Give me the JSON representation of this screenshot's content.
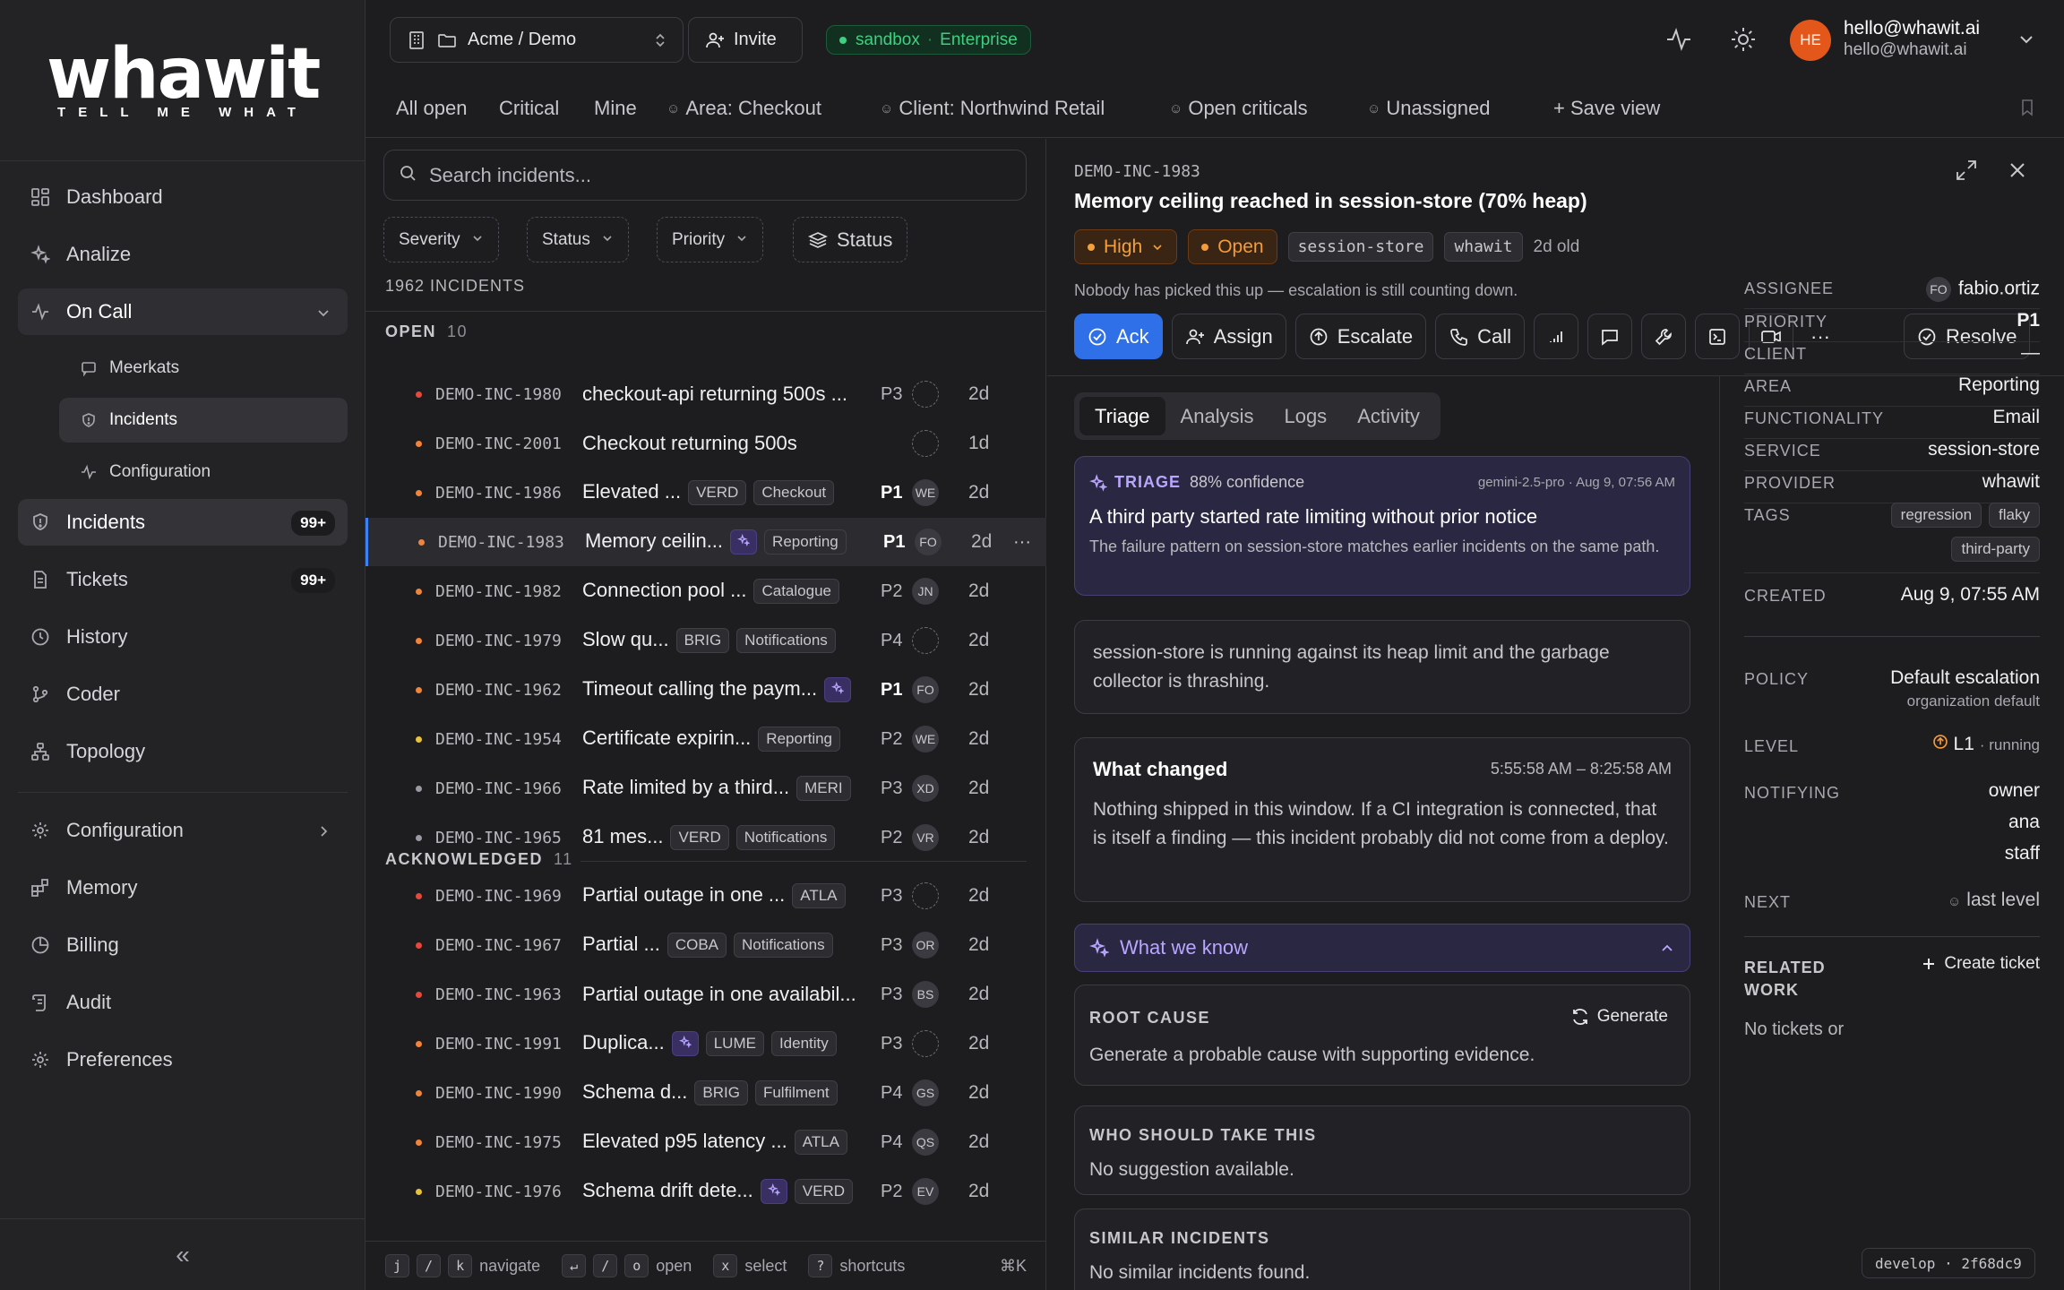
{
  "brand": {
    "name": "whawit",
    "tagline": "TELL ME WHAT"
  },
  "sidebar": {
    "items": [
      {
        "label": "Dashboard"
      },
      {
        "label": "Analize"
      },
      {
        "label": "On Call"
      },
      {
        "label": "Meerkats"
      },
      {
        "label": "Incidents"
      },
      {
        "label": "Configuration"
      },
      {
        "label": "Incidents",
        "badge": "99+"
      },
      {
        "label": "Tickets",
        "badge": "99+"
      },
      {
        "label": "History"
      },
      {
        "label": "Coder"
      },
      {
        "label": "Topology"
      },
      {
        "label": "Configuration"
      },
      {
        "label": "Memory"
      },
      {
        "label": "Billing"
      },
      {
        "label": "Audit"
      },
      {
        "label": "Preferences"
      }
    ],
    "collapse_glyph": "«"
  },
  "topbar": {
    "workspace": "Acme / Demo",
    "invite": "Invite",
    "env": "sandbox",
    "env_sep": "·",
    "plan": "Enterprise",
    "avatar_initials": "HE",
    "user_email": "hello@whawit.ai",
    "user_email_secondary": "hello@whawit.ai"
  },
  "views": [
    "All open",
    "Critical",
    "Mine",
    "Area: Checkout",
    "Client: Northwind Retail",
    "Open criticals",
    "Unassigned",
    "+ Save view"
  ],
  "list": {
    "search_placeholder": "Search incidents...",
    "filters": [
      "Severity",
      "Status",
      "Priority",
      "Status"
    ],
    "total": "1962 INCIDENTS",
    "groups": [
      {
        "name": "OPEN",
        "count": "10"
      },
      {
        "name": "ACKNOWLEDGED",
        "count": "11"
      }
    ],
    "rows": [
      {
        "id": "DEMO-INC-1980",
        "title": "checkout-api returning 500s ...",
        "chips": [],
        "prio": "P3",
        "av": "",
        "age": "2d",
        "dot": "#e8483c"
      },
      {
        "id": "DEMO-INC-2001",
        "title": "Checkout returning 500s",
        "chips": [],
        "prio": "",
        "av": "",
        "age": "1d",
        "dot": "#f0843c"
      },
      {
        "id": "DEMO-INC-1986",
        "title": "Elevated ...",
        "chips": [
          "VERD",
          "Checkout"
        ],
        "prio": "P1",
        "av": "WE",
        "age": "2d",
        "dot": "#f0843c"
      },
      {
        "id": "DEMO-INC-1983",
        "title": "Memory ceilin...",
        "chips": [
          "AI",
          "Reporting"
        ],
        "prio": "P1",
        "av": "FO",
        "age": "2d",
        "dot": "#f0843c",
        "selected": true,
        "more": "···"
      },
      {
        "id": "DEMO-INC-1982",
        "title": "Connection pool ...",
        "chips": [
          "Catalogue"
        ],
        "prio": "P2",
        "av": "JN",
        "age": "2d",
        "dot": "#f0843c"
      },
      {
        "id": "DEMO-INC-1979",
        "title": "Slow qu...",
        "chips": [
          "BRIG",
          "Notifications"
        ],
        "prio": "P4",
        "av": "",
        "age": "2d",
        "dot": "#f0843c"
      },
      {
        "id": "DEMO-INC-1962",
        "title": "Timeout calling the paym...",
        "chips": [
          "AI"
        ],
        "prio": "P1",
        "av": "FO",
        "age": "2d",
        "dot": "#f0843c"
      },
      {
        "id": "DEMO-INC-1954",
        "title": "Certificate expirin...",
        "chips": [
          "Reporting"
        ],
        "prio": "P2",
        "av": "WE",
        "age": "2d",
        "dot": "#e8c23c"
      },
      {
        "id": "DEMO-INC-1966",
        "title": "Rate limited by a third...",
        "chips": [
          "MERI"
        ],
        "prio": "P3",
        "av": "XD",
        "age": "2d",
        "dot": "#9a9aa2"
      },
      {
        "id": "DEMO-INC-1965",
        "title": "81 mes...",
        "chips": [
          "VERD",
          "Notifications"
        ],
        "prio": "P2",
        "av": "VR",
        "age": "2d",
        "dot": "#9a9aa2"
      },
      {
        "id": "DEMO-INC-1969",
        "title": "Partial outage in one ...",
        "chips": [
          "ATLA"
        ],
        "prio": "P3",
        "av": "",
        "age": "2d",
        "dot": "#e8483c"
      },
      {
        "id": "DEMO-INC-1967",
        "title": "Partial ...",
        "chips": [
          "COBA",
          "Notifications"
        ],
        "prio": "P3",
        "av": "OR",
        "age": "2d",
        "dot": "#e8483c"
      },
      {
        "id": "DEMO-INC-1963",
        "title": "Partial outage in one availabil...",
        "chips": [],
        "prio": "P3",
        "av": "BS",
        "age": "2d",
        "dot": "#e8483c"
      },
      {
        "id": "DEMO-INC-1991",
        "title": "Duplica...",
        "chips": [
          "AI",
          "LUME",
          "Identity"
        ],
        "prio": "P3",
        "av": "",
        "age": "2d",
        "dot": "#f0843c"
      },
      {
        "id": "DEMO-INC-1990",
        "title": "Schema d...",
        "chips": [
          "BRIG",
          "Fulfilment"
        ],
        "prio": "P4",
        "av": "GS",
        "age": "2d",
        "dot": "#f0843c"
      },
      {
        "id": "DEMO-INC-1975",
        "title": "Elevated p95 latency ...",
        "chips": [
          "ATLA"
        ],
        "prio": "P4",
        "av": "QS",
        "age": "2d",
        "dot": "#f0843c"
      },
      {
        "id": "DEMO-INC-1976",
        "title": "Schema drift dete...",
        "chips": [
          "AI",
          "VERD"
        ],
        "prio": "P2",
        "av": "EV",
        "age": "2d",
        "dot": "#e8c23c"
      }
    ],
    "shortcuts": [
      {
        "keys": [
          "j",
          "/",
          "k"
        ],
        "label": "navigate"
      },
      {
        "keys": [
          "↵",
          "/",
          "o"
        ],
        "label": "open"
      },
      {
        "keys": [
          "x"
        ],
        "label": "select"
      },
      {
        "keys": [
          "?"
        ],
        "label": "shortcuts"
      }
    ],
    "cmd_hint": "⌘K"
  },
  "detail": {
    "id": "DEMO-INC-1983",
    "title": "Memory ceiling reached in session-store (70% heap)",
    "severity": "High",
    "status": "Open",
    "service_chip": "session-store",
    "provider_chip": "whawit",
    "age": "2d old",
    "warning": "Nobody has picked this up — escalation is still counting down.",
    "actions": {
      "ack": "Ack",
      "assign": "Assign",
      "escalate": "Escalate",
      "call": "Call",
      "more": "···",
      "resolve": "Resolve"
    },
    "tabs": [
      "Triage",
      "Analysis",
      "Logs",
      "Activity"
    ],
    "triage": {
      "label": "TRIAGE",
      "confidence": "88% confidence",
      "meta": "gemini-2.5-pro · Aug 9, 07:56 AM",
      "title": "A third party started rate limiting without prior notice",
      "body": "The failure pattern on session-store matches earlier incidents on the same path."
    },
    "summary": "session-store is running against its heap limit and the garbage collector is thrashing.",
    "what_changed": {
      "title": "What changed",
      "time": "5:55:58 AM – 8:25:58 AM",
      "body": "Nothing shipped in this window. If a CI integration is connected, that is itself a finding — this incident probably did not come from a deploy."
    },
    "what_we_know": "What we know",
    "root_cause": {
      "title": "ROOT CAUSE",
      "body": "Generate a probable cause with supporting evidence.",
      "button": "Generate"
    },
    "who": {
      "title": "WHO SHOULD TAKE THIS",
      "body": "No suggestion available."
    },
    "similar": {
      "title": "SIMILAR INCIDENTS",
      "body": "No similar incidents found."
    }
  },
  "props": {
    "assignee": {
      "k": "ASSIGNEE",
      "av": "FO",
      "v": "fabio.ortiz"
    },
    "priority": {
      "k": "PRIORITY",
      "v": "P1"
    },
    "client": {
      "k": "CLIENT",
      "v": "—"
    },
    "area": {
      "k": "AREA",
      "v": "Reporting"
    },
    "functionality": {
      "k": "FUNCTIONALITY",
      "v": "Email"
    },
    "service": {
      "k": "SERVICE",
      "v": "session-store"
    },
    "provider": {
      "k": "PROVIDER",
      "v": "whawit"
    },
    "tags": {
      "k": "TAGS",
      "v": [
        "regression",
        "flaky",
        "third-party"
      ]
    },
    "created": {
      "k": "CREATED",
      "v": "Aug 9, 07:55 AM"
    },
    "policy": {
      "k": "POLICY",
      "v": "Default escalation",
      "sub": "organization default"
    },
    "level": {
      "k": "LEVEL",
      "v": "L1",
      "sub": "· running"
    },
    "notifying": {
      "k": "NOTIFYING",
      "v": [
        "owner",
        "ana",
        "staff"
      ]
    },
    "next": {
      "k": "NEXT",
      "v": "last level"
    },
    "related": {
      "k1": "RELATED",
      "k2": "WORK",
      "button": "Create ticket",
      "empty": "No tickets or"
    }
  },
  "build": "develop · 2f68dc9",
  "colors": {
    "accent": "#2f6fe8",
    "ai": "#b9a6ff",
    "warn": "#f59b3a",
    "ok": "#3fcf80"
  }
}
